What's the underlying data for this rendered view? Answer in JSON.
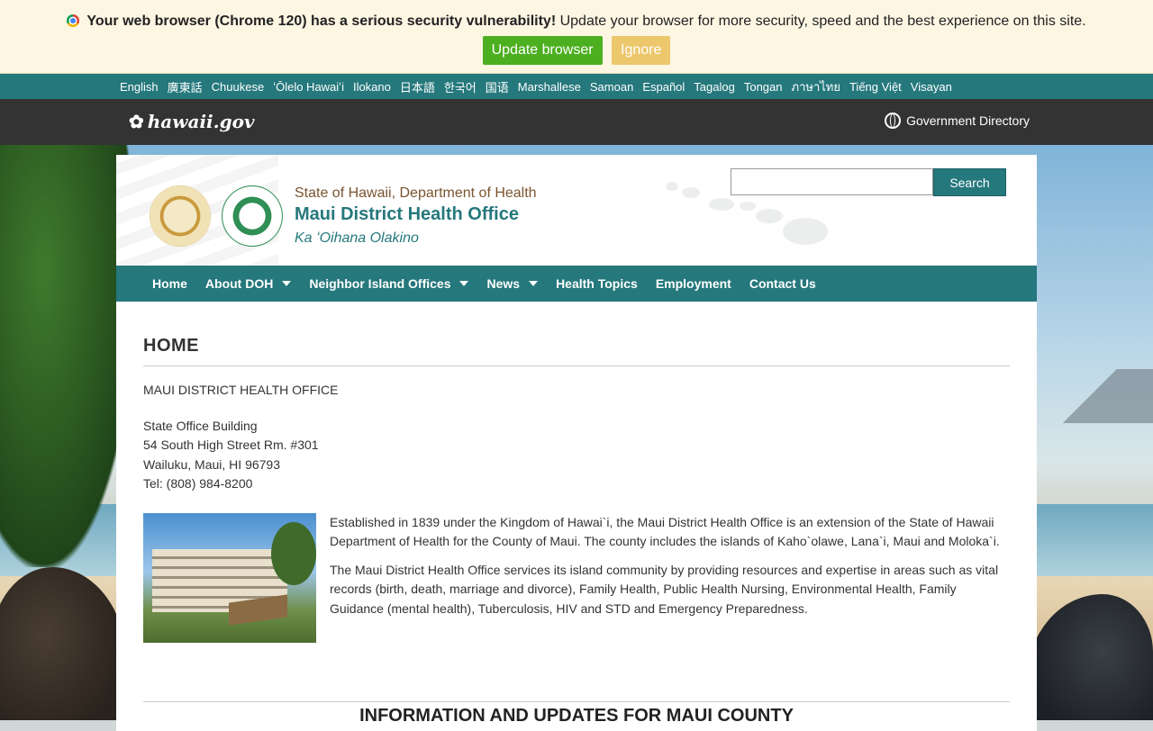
{
  "alert": {
    "bold": "Your web browser (Chrome 120) has a serious security vulnerability!",
    "text": " Update your browser for more security, speed and the best experience on this site.",
    "update_label": "Update browser",
    "ignore_label": "Ignore"
  },
  "languages": [
    "English",
    "廣東話",
    "Chuukese",
    "ʻŌlelo Hawaiʻi",
    "Ilokano",
    "日本語",
    "한국어",
    "国语",
    "Marshallese",
    "Samoan",
    "Español",
    "Tagalog",
    "Tongan",
    "ภาษาไทย",
    "Tiếng Việt",
    "Visayan"
  ],
  "portal": {
    "logo": "hawaii.gov",
    "directory": "Government Directory"
  },
  "header": {
    "department": "State of Hawaii, Department of Health",
    "office": "Maui District Health Office",
    "tagline": "Ka ʻOihana Olakino",
    "search_button": "Search",
    "search_value": ""
  },
  "nav": {
    "home": "Home",
    "about": "About DOH",
    "neighbor": "Neighbor Island Offices",
    "news": "News",
    "topics": "Health Topics",
    "employment": "Employment",
    "contact": "Contact Us"
  },
  "main": {
    "title": "HOME",
    "office_name": "MAUI DISTRICT HEALTH OFFICE",
    "address": [
      "State Office Building",
      "54 South High Street Rm. #301",
      "Wailuku, Maui, HI 96793",
      "Tel: (808) 984-8200"
    ],
    "para1": "Established in 1839 under the Kingdom of Hawai`i, the Maui District Health Office is an extension of the State of Hawaii Department of Health for the County of Maui. The county includes the islands of Kaho`olawe, Lana`i, Maui and Moloka`i.",
    "para2": "The Maui District Health Office services its island community by providing resources and expertise in areas such as vital records (birth, death, marriage and divorce), Family Health, Public Health Nursing, Environmental Health, Family Guidance (mental health), Tuberculosis, HIV and STD and Emergency Preparedness.",
    "section_title": "INFORMATION AND UPDATES FOR MAUI COUNTY"
  },
  "colors": {
    "teal": "#25787c",
    "update_green": "#4caf1f",
    "ignore_yellow": "#ecc76b"
  }
}
